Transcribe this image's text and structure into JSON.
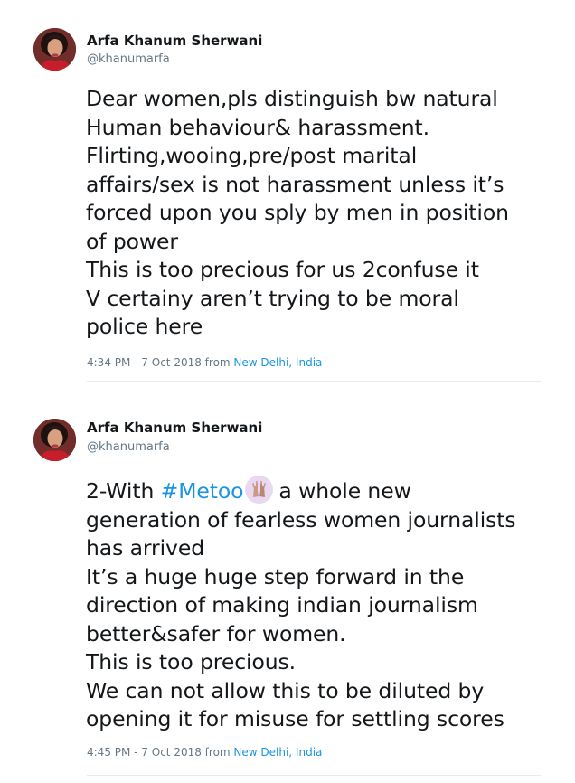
{
  "tweets": [
    {
      "author_name": "Arfa Khanum Sherwani",
      "author_handle": "@khanumarfa",
      "lines": [
        "Dear women,pls distinguish bw natural",
        "Human behaviour& harassment.",
        "Flirting,wooing,pre/post marital",
        "affairs/sex is not harassment unless it’s",
        "forced upon you sply by men in position",
        "of power",
        "This is too precious for us 2confuse it",
        "V certainy aren’t trying to be moral",
        "police here"
      ],
      "timestamp": "4:34 PM - 7 Oct 2018 from ",
      "location": "New Delhi, India"
    },
    {
      "author_name": "Arfa Khanum Sherwani",
      "author_handle": "@khanumarfa",
      "first_line_prefix": "2-With ",
      "hashtag": "#Metoo",
      "emoji_icon": "raised-hands-emoji-icon",
      "first_line_suffix": "a whole new",
      "lines": [
        "generation of fearless women journalists",
        "has arrived",
        "It’s a huge huge step forward in the",
        "direction of making indian journalism",
        "better&safer for women.",
        "This is too precious.",
        "We can not allow this to be diluted by",
        "opening it for misuse for settling scores"
      ],
      "timestamp": "4:45 PM - 7 Oct 2018 from ",
      "location": "New Delhi, India"
    }
  ],
  "colors": {
    "text": "#14171a",
    "muted": "#657786",
    "link": "#1b95e0",
    "divider": "#e6ecf0"
  }
}
